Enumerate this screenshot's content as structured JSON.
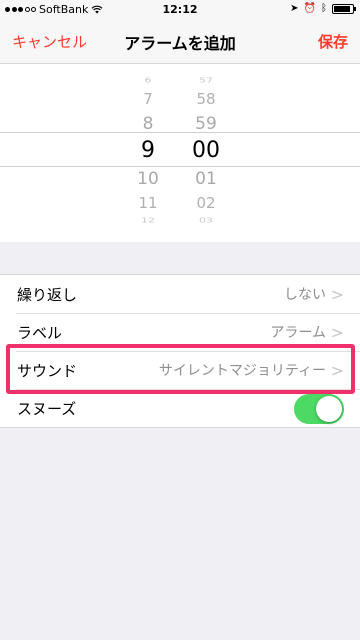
{
  "status_bar": {
    "carrier": "SoftBank",
    "time": "12:12",
    "signal_dots_filled": 3,
    "battery_level": 0.8
  },
  "nav": {
    "cancel": "キャンセル",
    "title": "アラームを追加",
    "save": "保存"
  },
  "picker": {
    "hours": [
      "6",
      "7",
      "8",
      "9",
      "10",
      "11",
      "12"
    ],
    "minutes": [
      "57",
      "58",
      "59",
      "00",
      "01",
      "02",
      "03"
    ],
    "selected_hour": "9",
    "selected_minute": "00"
  },
  "settings": {
    "repeat": {
      "label": "繰り返し",
      "value": "しない"
    },
    "label": {
      "label": "ラベル",
      "value": "アラーム"
    },
    "sound": {
      "label": "サウンド",
      "value": "サイレントマジョリティー"
    },
    "snooze": {
      "label": "スヌーズ",
      "on": true
    }
  },
  "colors": {
    "accent_red": "#ff3b30",
    "toggle_green": "#4cd964",
    "highlight_pink": "#f0306a"
  }
}
